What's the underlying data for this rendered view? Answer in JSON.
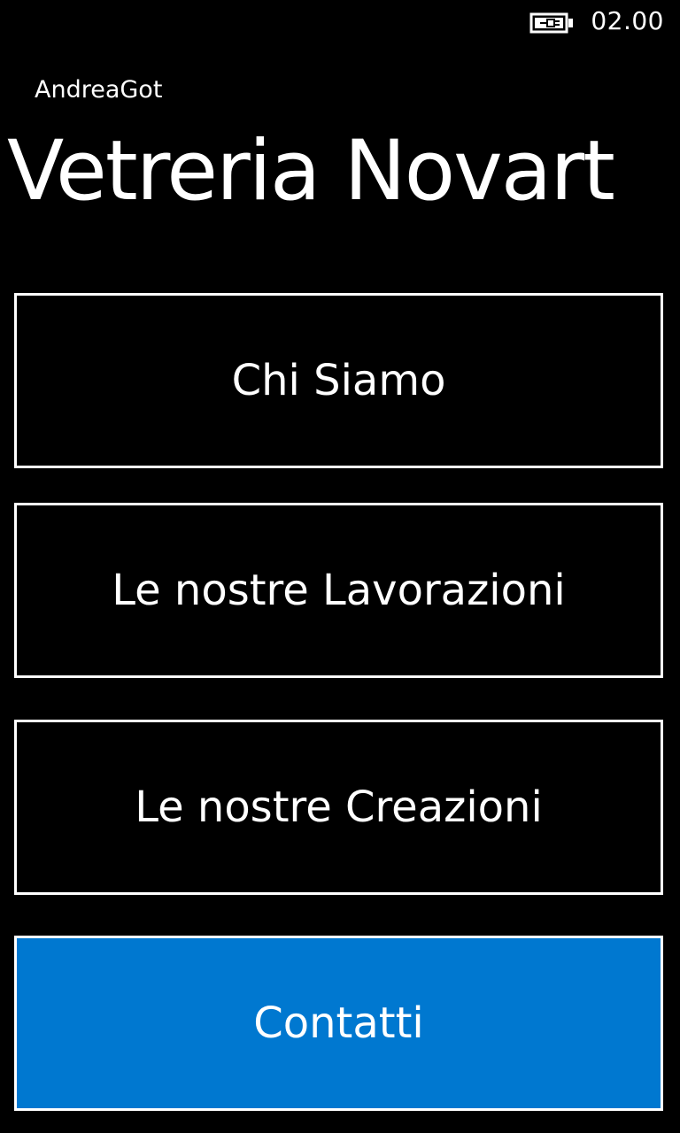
{
  "status_bar": {
    "battery_icon": "battery-charging-icon",
    "time": "02.00"
  },
  "header": {
    "app_name": "AndreaGot",
    "page_title": "Vetreria Novart"
  },
  "menu": {
    "items": [
      {
        "label": "Chi Siamo",
        "highlighted": false
      },
      {
        "label": "Le nostre Lavorazioni",
        "highlighted": false
      },
      {
        "label": "Le nostre Creazioni",
        "highlighted": false
      },
      {
        "label": "Contatti",
        "highlighted": true
      }
    ]
  },
  "colors": {
    "background": "#000000",
    "foreground": "#ffffff",
    "accent": "#0078d0"
  }
}
